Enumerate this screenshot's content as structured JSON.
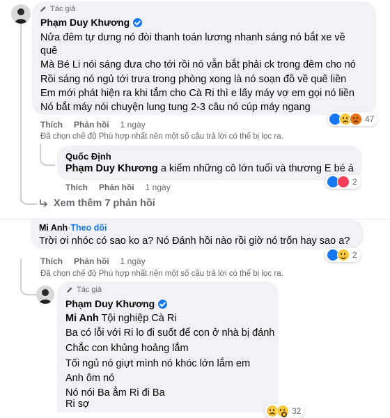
{
  "comment1": {
    "author_tag": "Tác giả",
    "name": "Phạm Duy Khương",
    "lines": [
      "Nửa đêm tự dưng nó đòi thanh toán lương nhanh sáng nó bắt xe về",
      "quê",
      "Mà Bé Li nói sáng đưa cho tới rồi nó vẫn bắt phải ck trong đêm cho nó",
      "Rồi sáng nó ngủ tới trưa trong phòng xong là nó soạn đồ về quê liền",
      "Em mới phát hiện ra khi tắm cho Cà Ri thì e lấy máy vợ em gọi nó liền",
      "Nó bắt máy nói chuyện lung tung 2-3 câu nó cúp máy ngang"
    ],
    "like_label": "Thích",
    "reply_label": "Phản hồi",
    "time": "1 ngày",
    "reaction_count": "47",
    "reaction_icons": [
      "like-icon",
      "sad-icon",
      "angry-icon"
    ]
  },
  "filter_note": "Đã chọn chế độ Phù hợp nhất nên một số câu trả lời có thể bị lọc ra.",
  "reply1": {
    "name": "Quốc Định",
    "mention": "Phạm Duy Khương",
    "text": " a kiếm những cô lớn tuổi và thương E bé á",
    "like_label": "Thích",
    "reply_label": "Phản hồi",
    "time": "1 ngày",
    "reaction_count": "2",
    "reaction_icons": [
      "like-icon",
      "love-icon"
    ]
  },
  "view_more": "Xem thêm 7 phản hồi",
  "comment2": {
    "name": "Mi Anh",
    "separator": " · ",
    "follow_label": "Theo dõi",
    "text": "Trời ơi nhóc có sao ko a? Nó Đánh hồi nào rồi giờ nó trốn hay sao a?",
    "like_label": "Thích",
    "reply_label": "Phản hồi",
    "time": "1 ngày",
    "reaction_count": "2",
    "reaction_icons": [
      "like-icon",
      "care-icon"
    ]
  },
  "reply2": {
    "author_tag": "Tác giả",
    "name": "Phạm Duy Khương",
    "mention": "Mi Anh",
    "first_line": " Tội nghiệp Cà Ri",
    "lines": [
      "Ba có lỗi với Ri lo đi suốt để con ở nhà bị đánh",
      "Chắc con khủng hoảng lắm",
      "Tối ngủ nó giựt mình nó khóc lớn lắm em",
      "Anh ôm nó",
      "Nó nói Ba ẳm Ri đi Ba",
      "Ri sợ"
    ],
    "reaction_count": "32",
    "reaction_icons": [
      "sad-icon",
      "wow-icon"
    ]
  },
  "colors": {
    "bubble": "#f0f2f5",
    "secondary_text": "#65676b",
    "accent_blue": "#1877f2",
    "thread_line": "#ced0d4"
  }
}
